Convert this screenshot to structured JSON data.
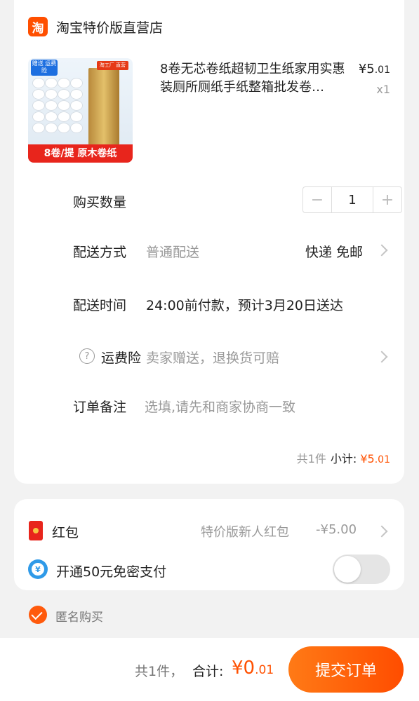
{
  "store": {
    "logo_char": "淘",
    "name": "淘宝特价版直营店"
  },
  "product": {
    "title": "8卷无芯卷纸超韧卫生纸家用实惠装厕所厕纸手纸整箱批发卷…",
    "price_symbol": "¥",
    "price_int": "5",
    "price_dec": ".01",
    "qty_text": "x1",
    "image": {
      "tag_left": "赠送 运费险",
      "tag_right": "淘工厂 直营",
      "banner": "8卷/提 原木卷纸"
    }
  },
  "quantity": {
    "label": "购买数量",
    "minus": "−",
    "value": "1",
    "plus": "+"
  },
  "delivery": {
    "label": "配送方式",
    "type": "普通配送",
    "value": "快递 免邮"
  },
  "delivery_time": {
    "label": "配送时间",
    "value": "24:00前付款，预计3月20日送达"
  },
  "insurance": {
    "icon": "?",
    "label": "运费险",
    "value": "卖家赠送，退换货可赔"
  },
  "note": {
    "label": "订单备注",
    "placeholder": "选填,请先和商家协商一致"
  },
  "subtotal": {
    "count": "共1件",
    "label": "小计:",
    "symbol": "¥",
    "int": "5",
    "dec": ".01"
  },
  "red_packet": {
    "label": "红包",
    "detail": "特价版新人红包",
    "amount": "-¥5.00"
  },
  "quick_pay": {
    "icon": "¥",
    "label": "开通50元免密支付",
    "enabled": false
  },
  "anonymous": {
    "label": "匿名购买",
    "checked": true
  },
  "footer": {
    "count": "共1件，",
    "total_label": "合计:",
    "symbol": "¥",
    "int": "0",
    "dec": ".01",
    "submit": "提交订单"
  },
  "colors": {
    "accent": "#ff5000",
    "brand": "#ff4f00",
    "red_packet": "#e8251c",
    "pay_blue": "#2f9ae8"
  }
}
